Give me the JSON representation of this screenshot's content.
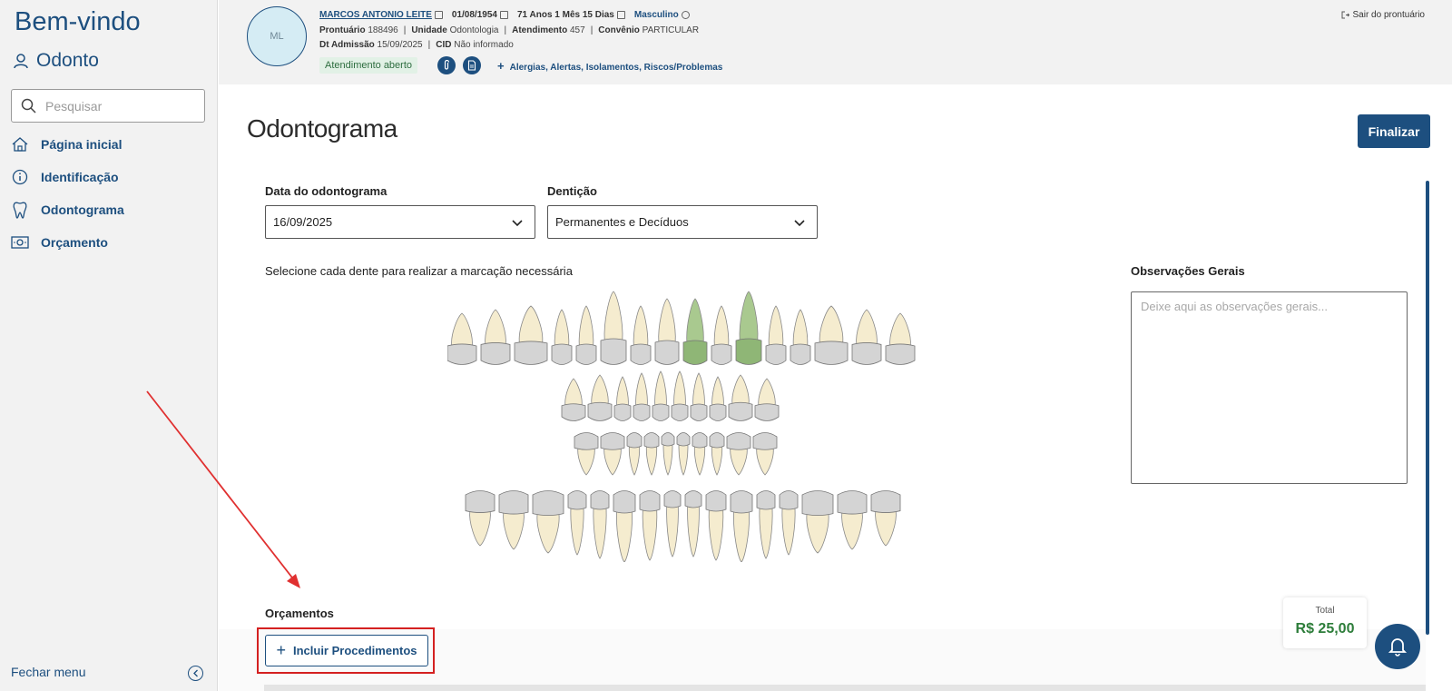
{
  "sidebar": {
    "welcome": "Bem-vindo",
    "app_name": "Odonto",
    "search_placeholder": "Pesquisar",
    "items": [
      {
        "label": "Página inicial",
        "icon": "home-icon"
      },
      {
        "label": "Identificação",
        "icon": "info-icon"
      },
      {
        "label": "Odontograma",
        "icon": "tooth-icon"
      },
      {
        "label": "Orçamento",
        "icon": "money-icon"
      }
    ],
    "close_menu": "Fechar menu"
  },
  "header": {
    "avatar_initials": "ML",
    "patient_name": "MARCOS ANTONIO LEITE",
    "birth_date": "01/08/1954",
    "age": "71 Anos 1 Mês 15 Dias",
    "sex": "Masculino",
    "prontuario_label": "Prontuário",
    "prontuario": "188496",
    "unidade_label": "Unidade",
    "unidade": "Odontologia",
    "atendimento_label": "Atendimento",
    "atendimento": "457",
    "convenio_label": "Convênio",
    "convenio": "PARTICULAR",
    "admissao_label": "Dt Admissão",
    "admissao": "15/09/2025",
    "cid_label": "CID",
    "cid": "Não informado",
    "status": "Atendimento aberto",
    "alerts_link": "Alergias, Alertas, Isolamentos, Riscos/Problemas",
    "exit": "Sair do prontuário"
  },
  "main": {
    "title": "Odontograma",
    "finalize": "Finalizar",
    "date_label": "Data do odontograma",
    "date_value": "16/09/2025",
    "dentition_label": "Dentição",
    "dentition_value": "Permanentes e Decíduos",
    "instruction": "Selecione cada dente para realizar a marcação necessária",
    "obs_label": "Observações Gerais",
    "obs_placeholder": "Deixe aqui as observações gerais...",
    "budgets_label": "Orçamentos",
    "add_procedures": "Incluir Procedimentos",
    "total_label": "Total",
    "total_value": "R$ 25,00"
  },
  "colors": {
    "primary": "#1d4f7f",
    "tooth": "#f5eccf",
    "crown": "#d4d4d4",
    "selected_tooth": "#a9c98f",
    "highlight": "#d42020",
    "total": "#2d7d3a"
  }
}
